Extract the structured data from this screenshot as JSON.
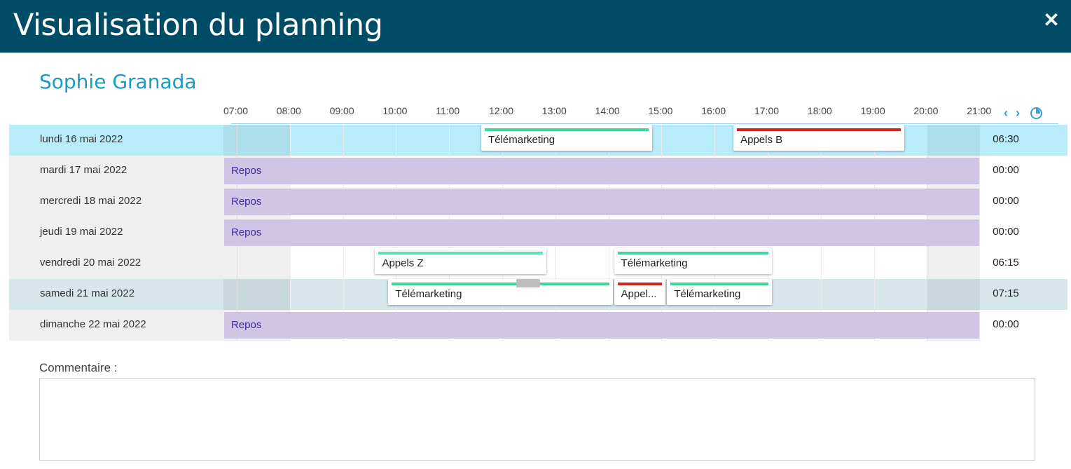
{
  "header": {
    "title": "Visualisation du planning",
    "close_icon": "close-icon"
  },
  "person": {
    "name": "Sophie Granada"
  },
  "timeline": {
    "hours": [
      "07:00",
      "08:00",
      "09:00",
      "10:00",
      "11:00",
      "12:00",
      "13:00",
      "14:00",
      "15:00",
      "16:00",
      "17:00",
      "18:00",
      "19:00",
      "20:00",
      "21:00"
    ],
    "prev_icon": "chevron-left-icon",
    "next_icon": "chevron-right-icon",
    "clock_icon": "clock-icon"
  },
  "colors": {
    "header_bg": "#004b66",
    "accent": "#1a9bc3",
    "telemarketing": "#3fd69a",
    "appels_z": "#5fe0b0",
    "appels_b": "#c8281e",
    "repos": "#d1c5e6",
    "repos_text": "#3c2a9a"
  },
  "days": [
    {
      "label": "lundi 16 mai 2022",
      "total": "06:30",
      "state": "highlight",
      "repos": "",
      "events": [
        {
          "label": "Télémarketing",
          "start": "11:45",
          "end": "15:00",
          "color": "#3fd69a"
        },
        {
          "label": "Appels B",
          "start": "16:30",
          "end": "19:45",
          "color": "#c8281e"
        }
      ]
    },
    {
      "label": "mardi 17 mai 2022",
      "total": "00:00",
      "state": "",
      "repos": "Repos",
      "events": []
    },
    {
      "label": "mercredi 18 mai 2022",
      "total": "00:00",
      "state": "",
      "repos": "Repos",
      "events": []
    },
    {
      "label": "jeudi 19 mai 2022",
      "total": "00:00",
      "state": "",
      "repos": "Repos",
      "events": []
    },
    {
      "label": "vendredi 20 mai 2022",
      "total": "06:15",
      "state": "",
      "repos": "",
      "events": [
        {
          "label": "Appels Z",
          "start": "09:45",
          "end": "13:00",
          "color": "#5fe0b0"
        },
        {
          "label": "Télémarketing",
          "start": "14:15",
          "end": "17:15",
          "color": "#3fd69a"
        }
      ]
    },
    {
      "label": "samedi 21 mai 2022",
      "total": "07:15",
      "state": "selected",
      "repos": "",
      "events": [
        {
          "label": "Télémarketing",
          "start": "10:00",
          "end": "14:15",
          "color": "#3fd69a"
        },
        {
          "label": "Appel...",
          "start": "14:15",
          "end": "15:15",
          "color": "#c8281e"
        },
        {
          "label": "Télémarketing",
          "start": "15:15",
          "end": "17:15",
          "color": "#3fd69a"
        }
      ]
    },
    {
      "label": "dimanche 22 mai 2022",
      "total": "00:00",
      "state": "",
      "repos": "Repos",
      "events": []
    }
  ],
  "comment": {
    "label": "Commentaire :",
    "value": ""
  }
}
